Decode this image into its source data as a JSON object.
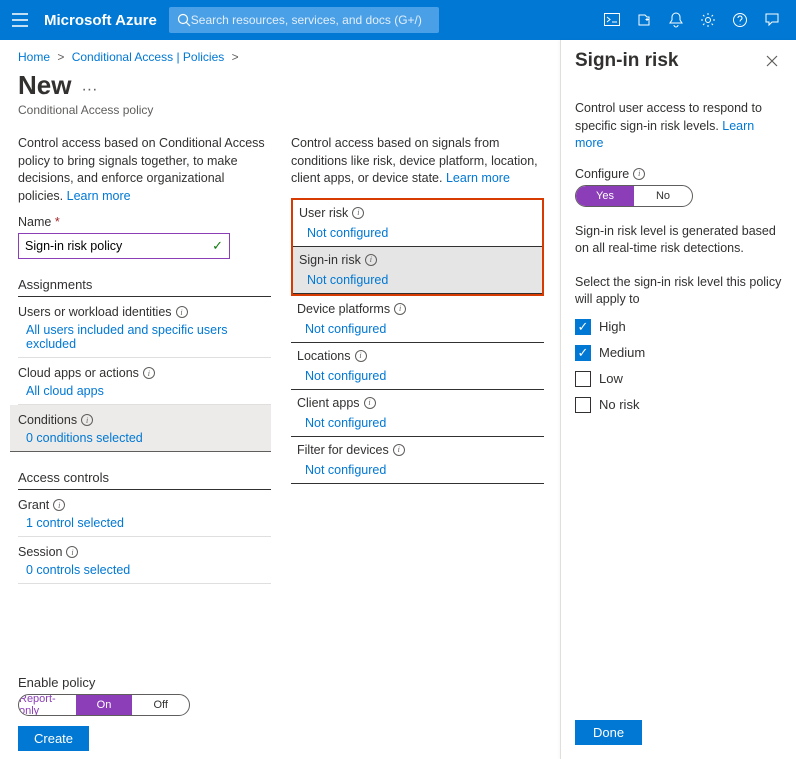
{
  "topbar": {
    "brand": "Microsoft Azure",
    "search_placeholder": "Search resources, services, and docs (G+/)"
  },
  "breadcrumb": {
    "home": "Home",
    "ca": "Conditional Access | Policies"
  },
  "header": {
    "title": "New",
    "subtitle": "Conditional Access policy"
  },
  "left_intro": "Control access based on Conditional Access policy to bring signals together, to make decisions, and enforce organizational policies.",
  "left_learn": "Learn more",
  "form": {
    "name_label": "Name",
    "name_value": "Sign-in risk policy"
  },
  "assignments": {
    "heading": "Assignments",
    "users_label": "Users or workload identities",
    "users_value": "All users included and specific users excluded",
    "apps_label": "Cloud apps or actions",
    "apps_value": "All cloud apps",
    "cond_label": "Conditions",
    "cond_value": "0 conditions selected"
  },
  "access": {
    "heading": "Access controls",
    "grant_label": "Grant",
    "grant_value": "1 control selected",
    "session_label": "Session",
    "session_value": "0 controls selected"
  },
  "right_intro": "Control access based on signals from conditions like risk, device platform, location, client apps, or device state.",
  "right_learn": "Learn more",
  "conditions": {
    "user_risk": "User risk",
    "user_risk_val": "Not configured",
    "signin_risk": "Sign-in risk",
    "signin_risk_val": "Not configured",
    "device_platforms": "Device platforms",
    "device_platforms_val": "Not configured",
    "locations": "Locations",
    "locations_val": "Not configured",
    "client_apps": "Client apps",
    "client_apps_val": "Not configured",
    "filter": "Filter for devices",
    "filter_val": "Not configured"
  },
  "enable_policy": {
    "label": "Enable policy",
    "report": "Report-only",
    "on": "On",
    "off": "Off"
  },
  "create": "Create",
  "panel": {
    "title": "Sign-in risk",
    "intro": "Control user access to respond to specific sign-in risk levels.",
    "learn": "Learn more",
    "configure": "Configure",
    "yes": "Yes",
    "no": "No",
    "desc1": "Sign-in risk level is generated based on all real-time risk detections.",
    "desc2": "Select the sign-in risk level this policy will apply to",
    "opt_high": "High",
    "opt_med": "Medium",
    "opt_low": "Low",
    "opt_none": "No risk",
    "done": "Done"
  }
}
